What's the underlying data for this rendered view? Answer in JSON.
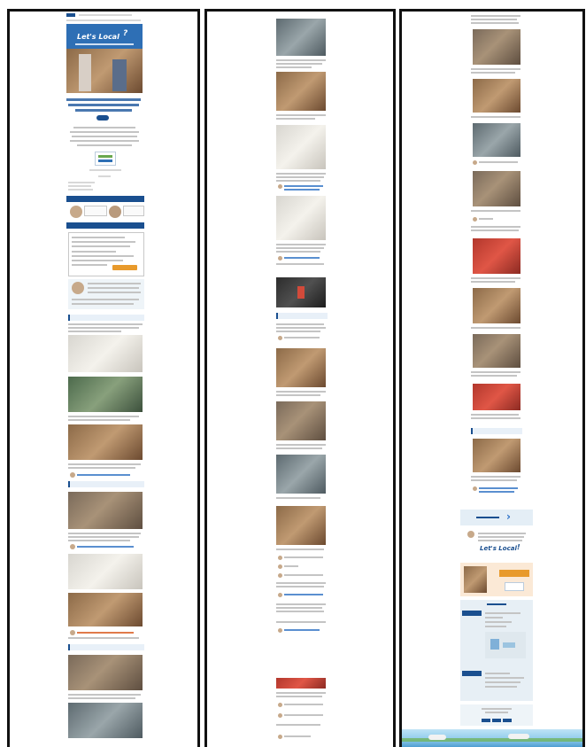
{
  "brand": {
    "logo_text": "Let's Local",
    "logo_mark": "?",
    "footer_logo_text": "Let's Local",
    "footer_logo_mark": "!"
  },
  "colors": {
    "brand_blue": "#1a4f8f",
    "accent_orange": "#e89a2c",
    "panel_border": "#111111"
  },
  "icons": {
    "next_arrow": "chevron-right-icon"
  }
}
